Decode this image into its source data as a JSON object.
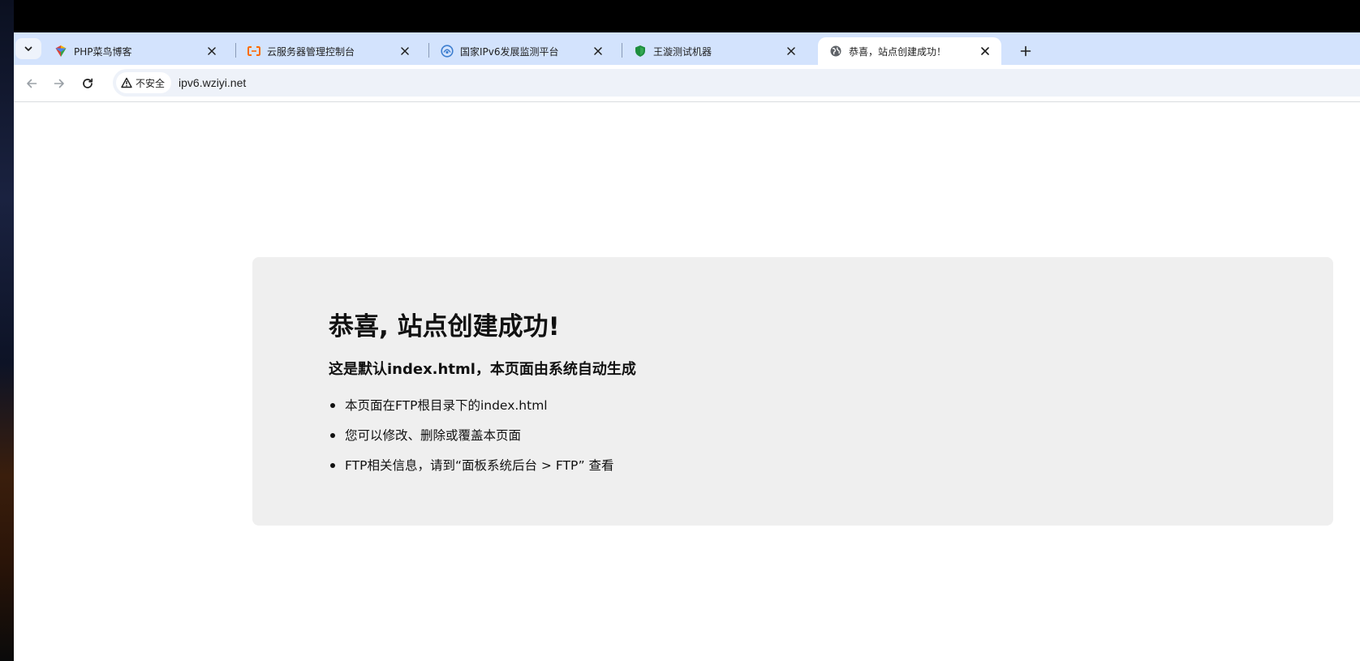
{
  "browser": {
    "tabs": [
      {
        "title": "PHP菜鸟博客",
        "icon": "php-blog-favicon-icon",
        "active": false
      },
      {
        "title": "云服务器管理控制台",
        "icon": "aliyun-favicon-icon",
        "active": false
      },
      {
        "title": "国家IPv6发展监测平台",
        "icon": "ipv6-monitor-favicon-icon",
        "active": false
      },
      {
        "title": "王漩测试机器",
        "icon": "shield-favicon-icon",
        "active": false
      },
      {
        "title": "恭喜，站点创建成功！",
        "icon": "globe-icon",
        "active": true
      }
    ],
    "security_label": "不安全",
    "url": "ipv6.wziyi.net"
  },
  "page": {
    "title": "恭喜, 站点创建成功!",
    "subtitle": "这是默认index.html，本页面由系统自动生成",
    "items": [
      "本页面在FTP根目录下的index.html",
      "您可以修改、删除或覆盖本页面",
      "FTP相关信息，请到“面板系统后台 > FTP” 查看"
    ]
  },
  "colors": {
    "tabstrip_bg": "#d3e3fd",
    "active_tab_bg": "#ffffff",
    "omnibox_bg": "#eef2f9",
    "card_bg": "#efefef",
    "aliyun_orange": "#ff6a00",
    "shield_green": "#1e8e3e"
  }
}
